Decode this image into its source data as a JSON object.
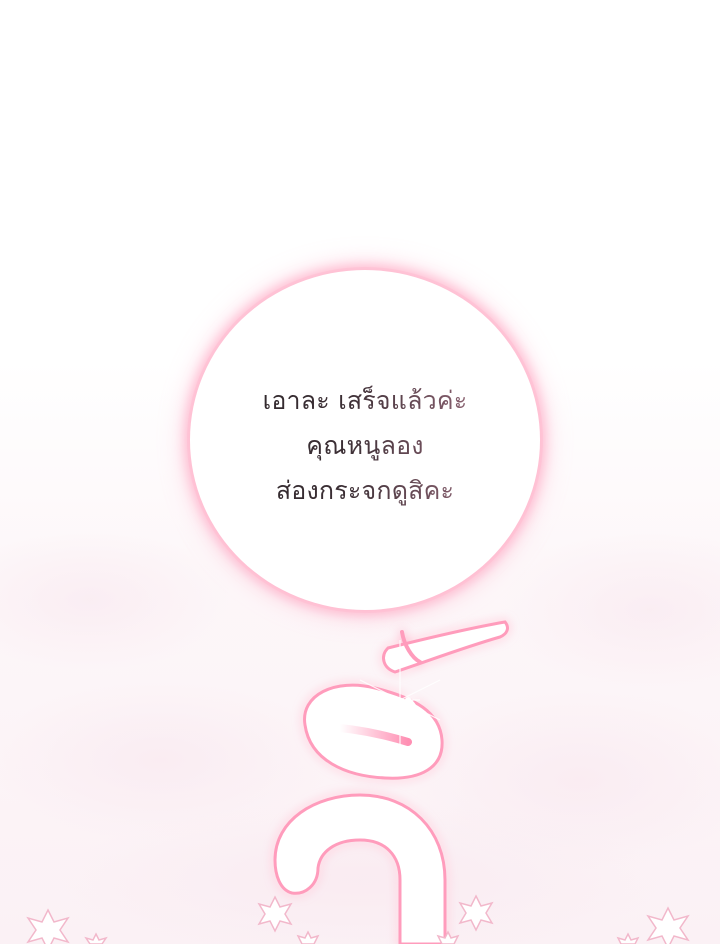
{
  "speech_bubble": {
    "lines": [
      "เอาละ เสร็จแล้วค่ะ",
      "คุณหนูลอง",
      "ส่องกระจกดูสิคะ"
    ]
  },
  "sound_effect": {
    "text": "วิ้",
    "glow_color": "#ff9cbc",
    "fill_color": "#ffffff",
    "inner_color": "#ff8fb3"
  },
  "colors": {
    "background_top": "#ffffff",
    "background_bottom": "#fbf1f5",
    "bubble_glow": "#ffb3c9",
    "text_dark": "#2b2528",
    "text_light": "#c4929f",
    "sparkle": "#f6c9d8"
  }
}
